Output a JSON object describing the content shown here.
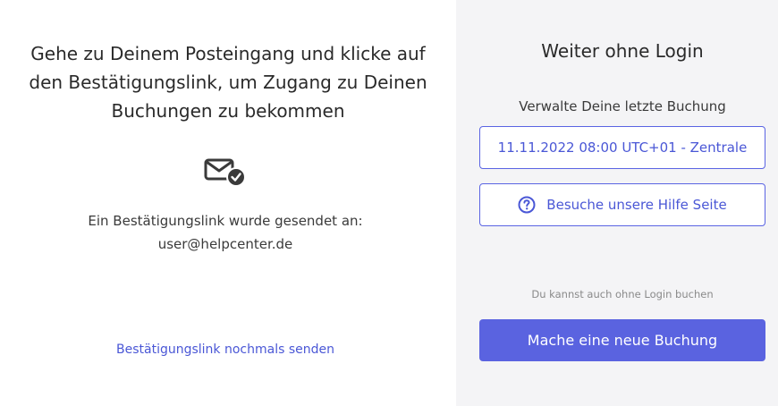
{
  "left": {
    "title": "Gehe zu Deinem Posteingang und klicke auf den Bestätigungslink, um Zugang zu Deinen Buchungen zu bekommen",
    "icon": "envelope-check-icon",
    "sent_line1": "Ein Bestätigungslink wurde gesendet an:",
    "email": "user@helpcenter.de",
    "resend_link": "Bestätigungslink nochmals senden"
  },
  "right": {
    "title": "Weiter ohne Login",
    "manage_label": "Verwalte Deine letzte Buchung",
    "booking_button": "11.11.2022 08:00 UTC+01 - Zentrale",
    "help_icon": "question-circle-icon",
    "help_button": "Besuche unsere Hilfe Seite",
    "no_login_text": "Du kannst auch ohne Login buchen",
    "new_booking_button": "Mache eine neue Buchung"
  },
  "colors": {
    "accent": "#5a63e0",
    "link": "#4a57d6",
    "right_bg": "#f4f4f6"
  }
}
